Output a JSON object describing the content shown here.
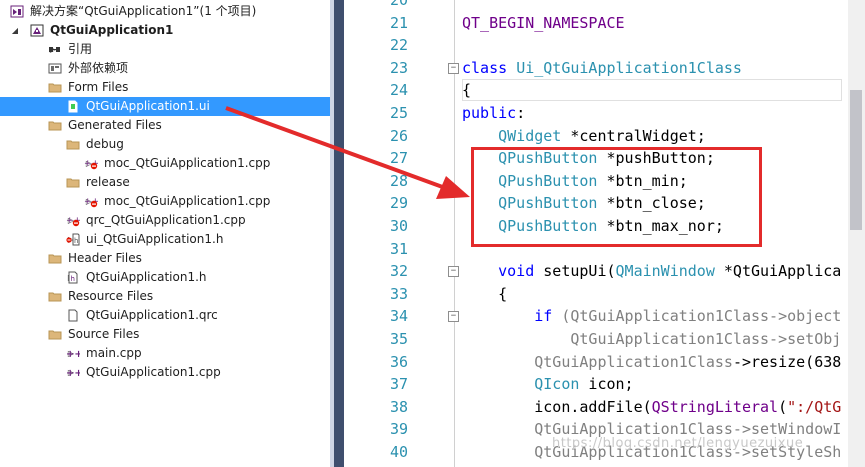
{
  "explorer": {
    "items": [
      {
        "label": "解决方案“QtGuiApplication1”(1 个项目)",
        "icon": "solution-icon",
        "level": 0,
        "expander": "none"
      },
      {
        "label": "QtGuiApplication1",
        "icon": "qt-project-icon",
        "level": 0,
        "expander": "expanded"
      },
      {
        "label": "引用",
        "icon": "references-icon",
        "level": 1,
        "expander": "collapsed"
      },
      {
        "label": "外部依赖项",
        "icon": "external-dependencies-icon",
        "level": 1,
        "expander": "collapsed"
      },
      {
        "label": "Form Files",
        "icon": "filter-folder-icon",
        "level": 1,
        "expander": "expanded"
      },
      {
        "label": "QtGuiApplication1.ui",
        "icon": "ui-file-icon",
        "level": 2,
        "expander": "none",
        "selected": true
      },
      {
        "label": "Generated Files",
        "icon": "filter-folder-icon",
        "level": 1,
        "expander": "expanded"
      },
      {
        "label": "debug",
        "icon": "filter-folder-icon",
        "level": 2,
        "expander": "expanded"
      },
      {
        "label": "moc_QtGuiApplication1.cpp",
        "icon": "cpp-file-excluded-icon",
        "level": 3,
        "expander": "collapsed"
      },
      {
        "label": "release",
        "icon": "filter-folder-icon",
        "level": 2,
        "expander": "expanded"
      },
      {
        "label": "moc_QtGuiApplication1.cpp",
        "icon": "cpp-file-excluded-icon",
        "level": 3,
        "expander": "collapsed"
      },
      {
        "label": "qrc_QtGuiApplication1.cpp",
        "icon": "cpp-file-excluded-icon",
        "level": 2,
        "expander": "collapsed"
      },
      {
        "label": "ui_QtGuiApplication1.h",
        "icon": "header-file-excluded-icon",
        "level": 2,
        "expander": "collapsed"
      },
      {
        "label": "Header Files",
        "icon": "filter-folder-icon",
        "level": 1,
        "expander": "expanded"
      },
      {
        "label": "QtGuiApplication1.h",
        "icon": "header-file-icon",
        "level": 2,
        "expander": "collapsed"
      },
      {
        "label": "Resource Files",
        "icon": "filter-folder-icon",
        "level": 1,
        "expander": "expanded"
      },
      {
        "label": "QtGuiApplication1.qrc",
        "icon": "resource-file-icon",
        "level": 2,
        "expander": "none"
      },
      {
        "label": "Source Files",
        "icon": "filter-folder-icon",
        "level": 1,
        "expander": "expanded"
      },
      {
        "label": "main.cpp",
        "icon": "cpp-file-icon",
        "level": 2,
        "expander": "collapsed"
      },
      {
        "label": "QtGuiApplication1.cpp",
        "icon": "cpp-file-icon",
        "level": 2,
        "expander": "collapsed"
      }
    ]
  },
  "editor": {
    "lines": [
      {
        "num": "20",
        "code": [
          {
            "t": "",
            "c": ""
          }
        ]
      },
      {
        "num": "21",
        "code": [
          {
            "t": "QT_BEGIN_NAMESPACE",
            "c": "mac"
          }
        ]
      },
      {
        "num": "22",
        "code": [
          {
            "t": "",
            "c": ""
          }
        ]
      },
      {
        "num": "23",
        "fold": "−",
        "code": [
          {
            "t": "class ",
            "c": "kw"
          },
          {
            "t": "Ui_QtGuiApplication1Class",
            "c": "ty"
          }
        ]
      },
      {
        "num": "24",
        "code": [
          {
            "t": "{",
            "c": ""
          }
        ]
      },
      {
        "num": "25",
        "code": [
          {
            "t": "public",
            "c": "kw"
          },
          {
            "t": ":",
            "c": ""
          }
        ]
      },
      {
        "num": "26",
        "code": [
          {
            "t": "    ",
            "c": ""
          },
          {
            "t": "QWidget",
            "c": "ty"
          },
          {
            "t": " *centralWidget;",
            "c": ""
          }
        ]
      },
      {
        "num": "27",
        "code": [
          {
            "t": "    ",
            "c": ""
          },
          {
            "t": "QPushButton",
            "c": "ty"
          },
          {
            "t": " *pushButton;",
            "c": ""
          }
        ]
      },
      {
        "num": "28",
        "code": [
          {
            "t": "    ",
            "c": ""
          },
          {
            "t": "QPushButton",
            "c": "ty"
          },
          {
            "t": " *btn_min;",
            "c": ""
          }
        ]
      },
      {
        "num": "29",
        "code": [
          {
            "t": "    ",
            "c": ""
          },
          {
            "t": "QPushButton",
            "c": "ty"
          },
          {
            "t": " *btn_close;",
            "c": ""
          }
        ]
      },
      {
        "num": "30",
        "code": [
          {
            "t": "    ",
            "c": ""
          },
          {
            "t": "QPushButton",
            "c": "ty"
          },
          {
            "t": " *btn_max_nor;",
            "c": ""
          }
        ]
      },
      {
        "num": "31",
        "code": [
          {
            "t": "",
            "c": ""
          }
        ]
      },
      {
        "num": "32",
        "fold": "−",
        "code": [
          {
            "t": "    ",
            "c": ""
          },
          {
            "t": "void",
            "c": "kw"
          },
          {
            "t": " setupUi(",
            "c": ""
          },
          {
            "t": "QMainWindow",
            "c": "ty"
          },
          {
            "t": " *QtGuiApplica",
            "c": ""
          }
        ]
      },
      {
        "num": "33",
        "code": [
          {
            "t": "    {",
            "c": ""
          }
        ]
      },
      {
        "num": "34",
        "fold": "−",
        "code": [
          {
            "t": "        ",
            "c": ""
          },
          {
            "t": "if",
            "c": "kw"
          },
          {
            "t": " (QtGuiApplication1Class->object",
            "c": "gray"
          }
        ]
      },
      {
        "num": "35",
        "code": [
          {
            "t": "            QtGuiApplication1Class->setObj",
            "c": "gray"
          }
        ]
      },
      {
        "num": "36",
        "code": [
          {
            "t": "        ",
            "c": ""
          },
          {
            "t": "QtGuiApplication1Class",
            "c": "gray"
          },
          {
            "t": "->resize(638",
            "c": ""
          }
        ]
      },
      {
        "num": "37",
        "code": [
          {
            "t": "        ",
            "c": ""
          },
          {
            "t": "QIcon",
            "c": "ty"
          },
          {
            "t": " icon;",
            "c": ""
          }
        ]
      },
      {
        "num": "38",
        "code": [
          {
            "t": "        icon.addFile(",
            "c": ""
          },
          {
            "t": "QStringLiteral",
            "c": "mac"
          },
          {
            "t": "(",
            "c": ""
          },
          {
            "t": "\":/QtG",
            "c": "str"
          }
        ]
      },
      {
        "num": "39",
        "code": [
          {
            "t": "        QtGuiApplication1Class->setWindowI",
            "c": "gray"
          }
        ]
      },
      {
        "num": "40",
        "code": [
          {
            "t": "        QtGuiApplication1Class->setStyleSh",
            "c": "gray"
          }
        ]
      }
    ]
  },
  "watermark": "https://blog.csdn.net/lengyuezuixue",
  "colors": {
    "selection": "#3399ff",
    "annotation": "#e32b2b",
    "line_numbers": "#2b91af",
    "keyword": "#0000ff",
    "type": "#2b91af",
    "macro": "#6f008a"
  }
}
